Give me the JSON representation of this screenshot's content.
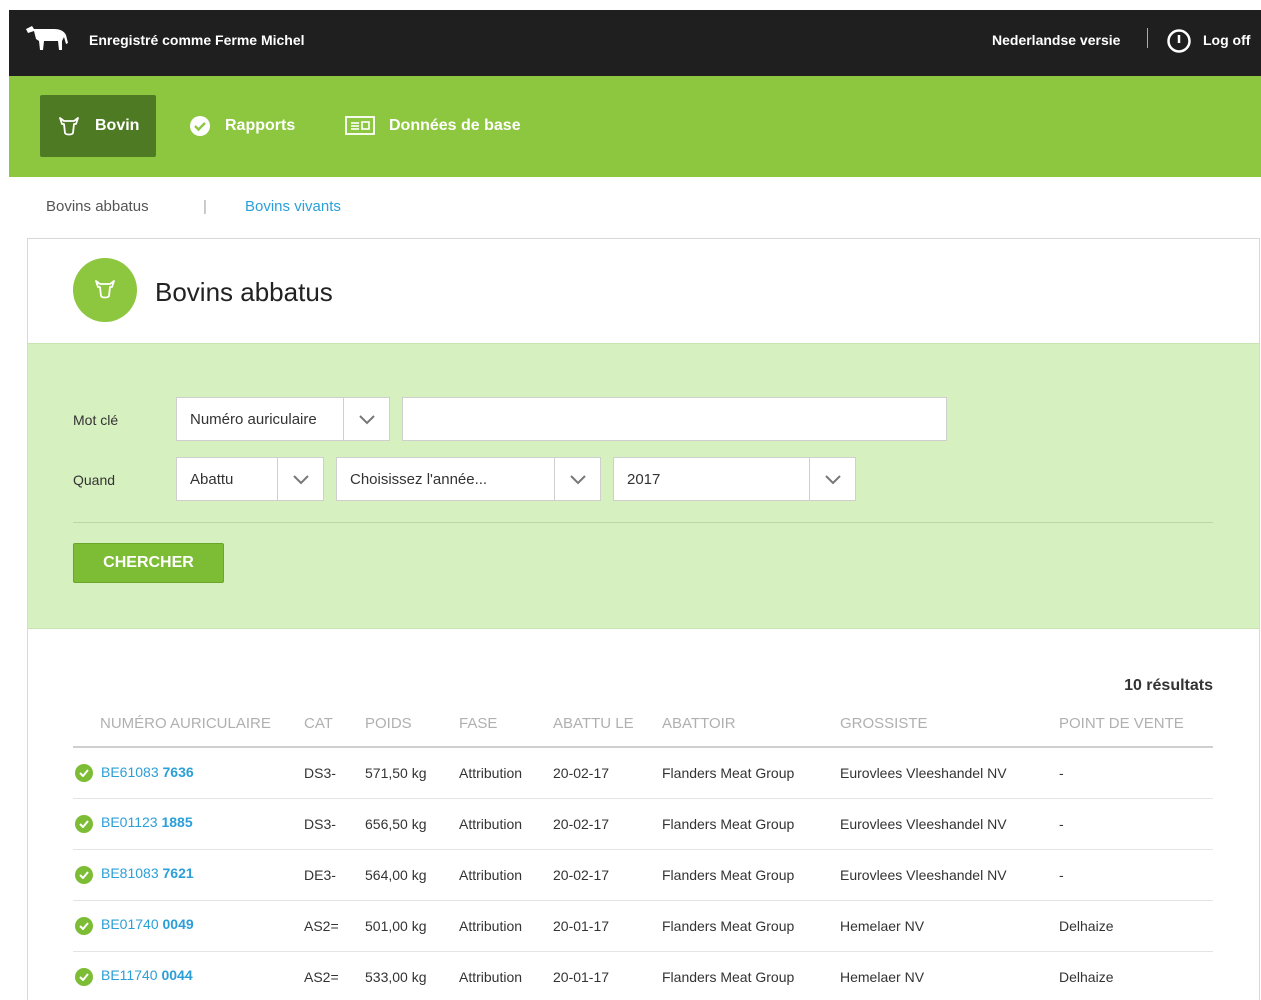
{
  "topbar": {
    "logo_icon": "cow-icon",
    "registered_as": "Enregistré comme Ferme Michel",
    "language_link": "Nederlandse versie",
    "power_icon": "power-icon",
    "logoff": "Log off"
  },
  "nav": {
    "items": [
      {
        "label": "Bovin",
        "icon": "cow-head-icon",
        "active": true
      },
      {
        "label": "Rapports",
        "icon": "check-circle-icon",
        "active": false
      },
      {
        "label": "Données de base",
        "icon": "id-card-icon",
        "active": false
      }
    ]
  },
  "subnav": {
    "slaughtered": "Bovins abbatus",
    "separator": "|",
    "alive": "Bovins vivants"
  },
  "panel": {
    "title": "Bovins abbatus",
    "icon": "cow-head-icon"
  },
  "filters": {
    "keyword_label": "Mot clé",
    "keyword_type": "Numéro auriculaire",
    "keyword_value": "",
    "when_label": "Quand",
    "when_type": "Abattu",
    "year_mode": "Choisissez l'année...",
    "year": "2017",
    "search_button": "CHERCHER"
  },
  "results": {
    "count": "10 résultats",
    "columns": [
      "NUMÉRO AURICULAIRE",
      "CAT",
      "POIDS",
      "FASE",
      "ABATTU LE",
      "ABATTOIR",
      "GROSSISTE",
      "POINT DE VENTE"
    ],
    "rows": [
      {
        "prefix": "BE61083",
        "num": "7636",
        "cat": "DS3-",
        "poids": "571,50 kg",
        "fase": "Attribution",
        "date": "20-02-17",
        "abattoir": "Flanders Meat Group",
        "grossiste": "Eurovlees Vleeshandel NV",
        "point": "-"
      },
      {
        "prefix": "BE01123",
        "num": "1885",
        "cat": "DS3-",
        "poids": "656,50 kg",
        "fase": "Attribution",
        "date": "20-02-17",
        "abattoir": "Flanders Meat Group",
        "grossiste": "Eurovlees Vleeshandel NV",
        "point": "-"
      },
      {
        "prefix": "BE81083",
        "num": "7621",
        "cat": "DE3-",
        "poids": "564,00 kg",
        "fase": "Attribution",
        "date": "20-02-17",
        "abattoir": "Flanders Meat Group",
        "grossiste": "Eurovlees Vleeshandel NV",
        "point": "-"
      },
      {
        "prefix": "BE01740",
        "num": "0049",
        "cat": "AS2=",
        "poids": "501,00 kg",
        "fase": "Attribution",
        "date": "20-01-17",
        "abattoir": "Flanders Meat Group",
        "grossiste": "Hemelaer NV",
        "point": "Delhaize"
      },
      {
        "prefix": "BE11740",
        "num": "0044",
        "cat": "AS2=",
        "poids": "533,00 kg",
        "fase": "Attribution",
        "date": "20-01-17",
        "abattoir": "Flanders Meat Group",
        "grossiste": "Hemelaer NV",
        "point": "Delhaize"
      }
    ]
  }
}
